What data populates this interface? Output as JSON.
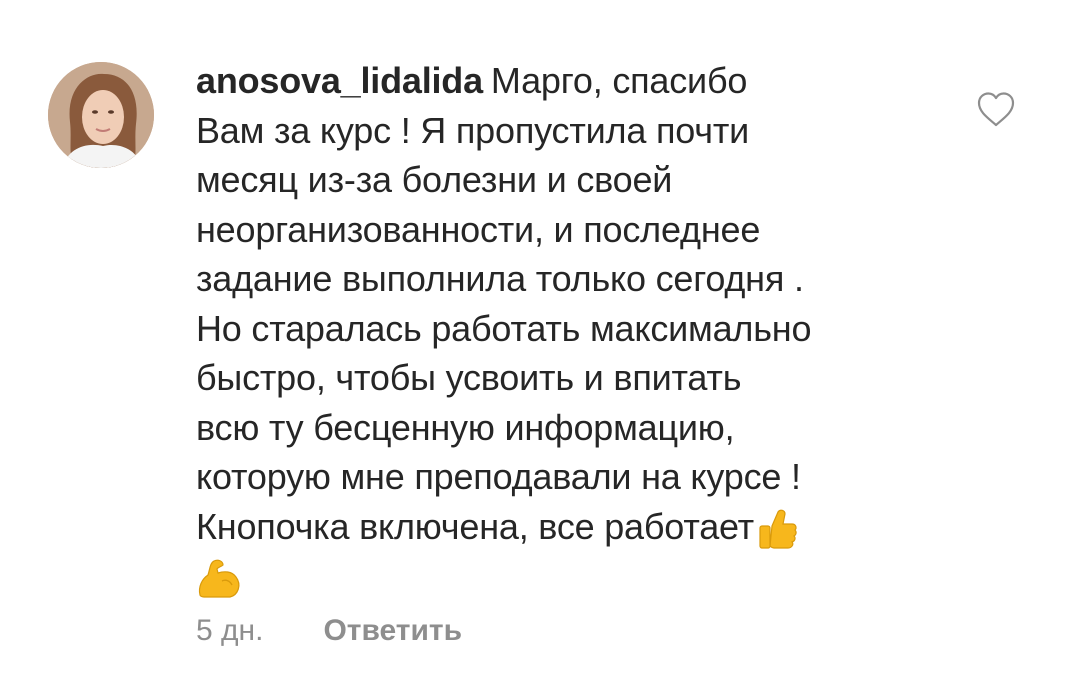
{
  "comment": {
    "username": "anosova_lidalida",
    "lines": [
      "Марго, спасибо",
      "Вам за курс ! Я пропустила почти",
      "месяц из-за болезни и своей",
      "неорганизованности, и последнее",
      "задание выполнила только сегодня .",
      "Но старалась работать максимально",
      "быстро, чтобы усвоить и впитать",
      "всю ту бесценную информацию,",
      "которую мне преподавали на курсе !",
      "Кнопочка включена, все работает"
    ],
    "emojis": [
      "thumbs-up",
      "flexed-biceps"
    ],
    "time": "5 дн.",
    "reply_label": "Ответить"
  },
  "icons": {
    "like": "heart-outline-icon"
  },
  "colors": {
    "text": "#262626",
    "secondary": "#8e8e8e",
    "emoji": "#f7b71c"
  }
}
